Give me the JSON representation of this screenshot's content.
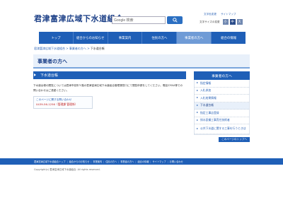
{
  "header": {
    "site_title": "君津富津広域下水道組合",
    "search_placeholder": "Google 検索",
    "top_links": [
      "文字色変更",
      "サイトマップ"
    ],
    "fontsize_label": "文字サイズの変更",
    "fontsize_buttons": [
      "小",
      "中",
      "大"
    ]
  },
  "nav": {
    "items": [
      "トップ",
      "組合からのお知らせ",
      "事業案内",
      "住民の方へ",
      "事業者の方へ",
      "組合の情報"
    ],
    "active_index": 4
  },
  "breadcrumb": {
    "items": [
      "君津富津広域下水道組合",
      "事業者の方へ"
    ],
    "current": "下水道台帳"
  },
  "page_heading": "事業者の方へ",
  "main": {
    "section_title": "下水道台帳",
    "body": "下水道台帳の閲覧については君津市役所５階の君津富津広域下水道組合管理課窓口にて閲覧申請をしてください。電話やFAX等での問い合わせはご遠慮ください。",
    "contact_title": "このページに関する問い合わせ",
    "contact_phone": "0439-56-1256（管理課 管理係）"
  },
  "sidebar": {
    "heading": "事業者の方へ",
    "items": [
      "指定情報",
      "入札参加",
      "入札結果情報",
      "下水道台帳",
      "指定工事店登録",
      "排水設備工事責任技術者",
      "公共下水道に関する工事を行うときは"
    ],
    "active_index": 3,
    "more_label": "このページのトップへ"
  },
  "footer": {
    "links": [
      "君津富津広域下水道組合トップ",
      "組合からのお知らせ",
      "事業案内",
      "住民の方へ",
      "事業者の方へ",
      "組合の情報",
      "サイトマップ",
      "お問い合わせ"
    ],
    "copyright": "Copyright(c) 君津富津広域下水道組合. All rights reserved."
  },
  "colors": {
    "brand_blue": "#1f5fb7",
    "title_navy": "#1b3f87",
    "link_blue": "#2a62b6",
    "phone_red": "#c02020"
  }
}
